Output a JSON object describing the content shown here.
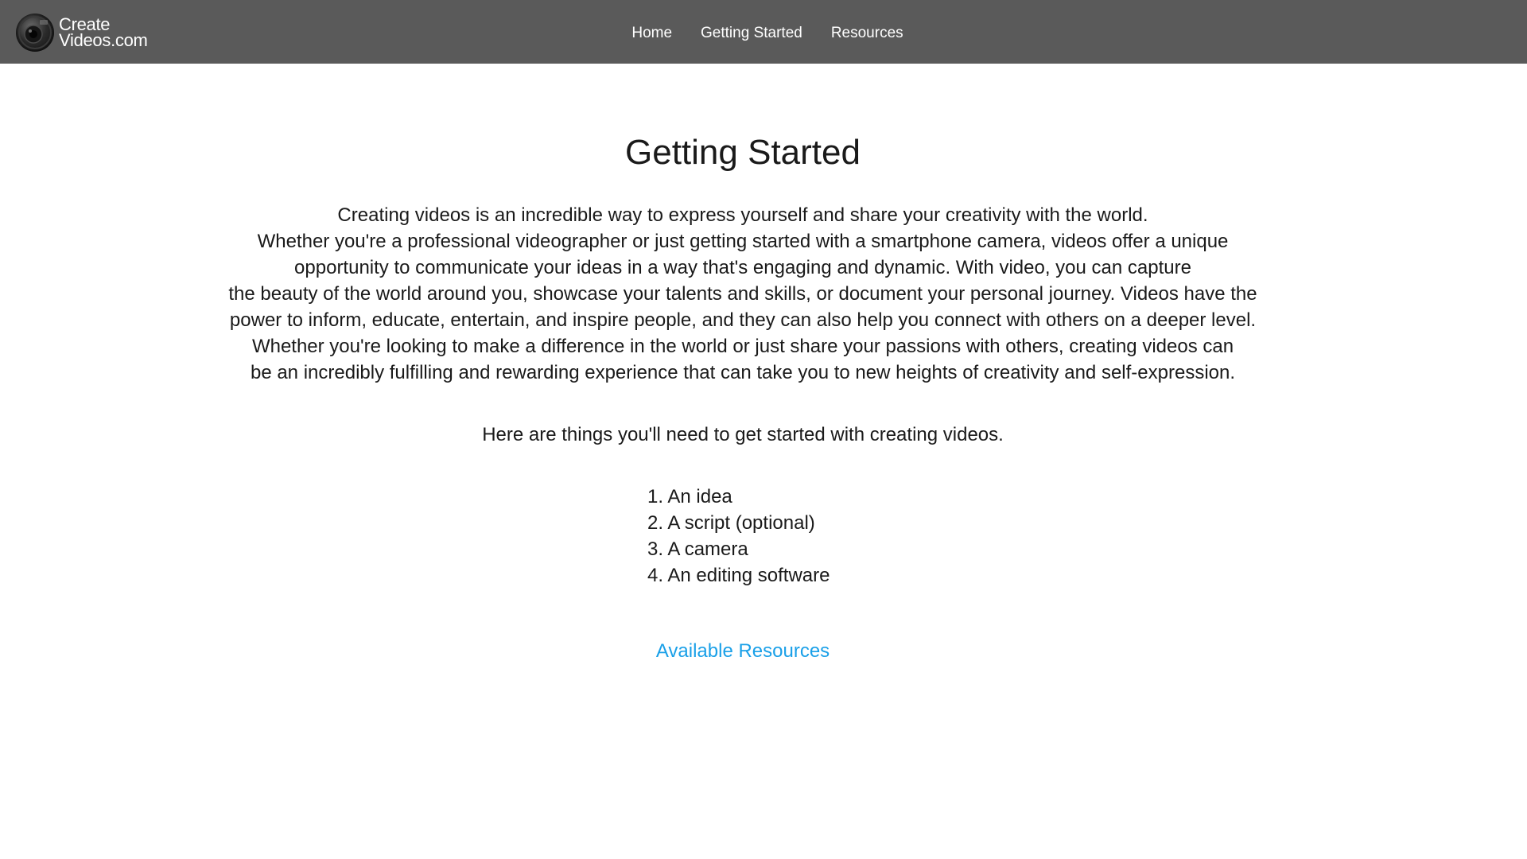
{
  "header": {
    "brand": {
      "line1": "Create",
      "line2": "Videos.com",
      "logo_icon": "camera-lens-icon"
    },
    "nav": [
      {
        "label": "Home"
      },
      {
        "label": "Getting Started"
      },
      {
        "label": "Resources"
      }
    ],
    "background_color": "#5a5a5a"
  },
  "main": {
    "title": "Getting Started",
    "intro_lines": [
      "Creating videos is an incredible way to express yourself and share your creativity with the world.",
      "Whether you're a professional  videographer or just getting started with a smartphone camera, videos offer a unique",
      "opportunity to communicate your ideas in a way that's engaging and dynamic. With video, you can capture",
      "the beauty of the world around you, showcase your talents and skills,  or document your personal journey. Videos have the",
      "power to inform, educate, entertain, and inspire people, and they can also help you connect with others on a deeper level.",
      "Whether you're looking to make a difference in the world or just share your passions with others, creating videos can",
      "be an incredibly fulfilling and rewarding experience that can take you to new heights of creativity and self-expression."
    ],
    "needs_text": "Here are things you'll need to get started with creating videos.",
    "steps": [
      "1. An idea",
      "2. A script (optional)",
      "3. A camera",
      "4. An editing software"
    ],
    "resources_link": "Available Resources",
    "link_color": "#1aa0e8"
  }
}
